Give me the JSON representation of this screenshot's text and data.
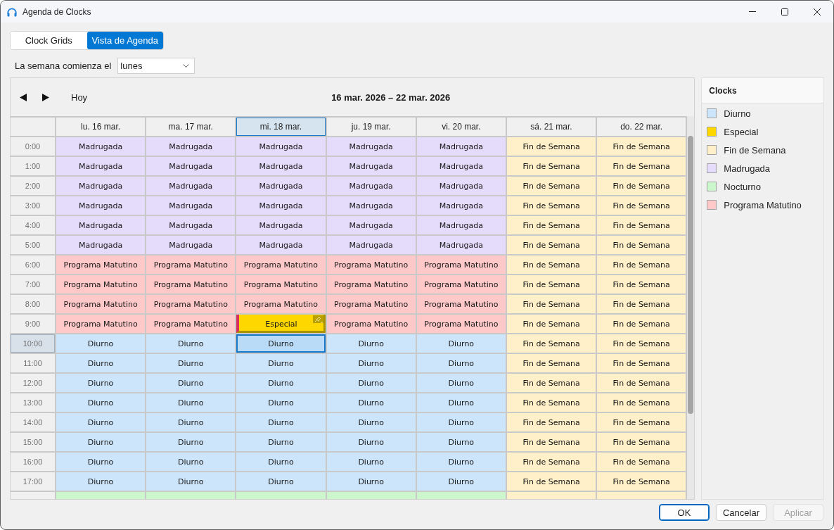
{
  "window": {
    "title": "Agenda de Clocks"
  },
  "tabs": [
    {
      "label": "Clock Grids",
      "selected": false
    },
    {
      "label": "Vista de Agenda",
      "selected": true
    }
  ],
  "week_start": {
    "label": "La semana comienza el",
    "value": "lunes"
  },
  "calendar": {
    "today_button": "Hoy",
    "range_title": "16 mar. 2026 – 22 mar. 2026",
    "days": [
      {
        "label": "lu. 16 mar.",
        "selected": false
      },
      {
        "label": "ma. 17 mar.",
        "selected": false
      },
      {
        "label": "mi. 18 mar.",
        "selected": true
      },
      {
        "label": "ju. 19 mar.",
        "selected": false
      },
      {
        "label": "vi. 20 mar.",
        "selected": false
      },
      {
        "label": "sá. 21 mar.",
        "selected": false
      },
      {
        "label": "do. 22 mar.",
        "selected": false
      }
    ],
    "rows": [
      {
        "time": "0:00",
        "selected": false,
        "cells": [
          {
            "text": "Madrugada",
            "color": "#e5dcfc",
            "pinned": false,
            "selected": false
          },
          {
            "text": "Madrugada",
            "color": "#e5dcfc",
            "pinned": false,
            "selected": false
          },
          {
            "text": "Madrugada",
            "color": "#e5dcfc",
            "pinned": false,
            "selected": false
          },
          {
            "text": "Madrugada",
            "color": "#e5dcfc",
            "pinned": false,
            "selected": false
          },
          {
            "text": "Madrugada",
            "color": "#e5dcfc",
            "pinned": false,
            "selected": false
          },
          {
            "text": "Fin de Semana",
            "color": "#fff0c9",
            "pinned": false,
            "selected": false
          },
          {
            "text": "Fin de Semana",
            "color": "#fff0c9",
            "pinned": false,
            "selected": false
          }
        ]
      },
      {
        "time": "1:00",
        "selected": false,
        "cells": [
          {
            "text": "Madrugada",
            "color": "#e5dcfc",
            "pinned": false,
            "selected": false
          },
          {
            "text": "Madrugada",
            "color": "#e5dcfc",
            "pinned": false,
            "selected": false
          },
          {
            "text": "Madrugada",
            "color": "#e5dcfc",
            "pinned": false,
            "selected": false
          },
          {
            "text": "Madrugada",
            "color": "#e5dcfc",
            "pinned": false,
            "selected": false
          },
          {
            "text": "Madrugada",
            "color": "#e5dcfc",
            "pinned": false,
            "selected": false
          },
          {
            "text": "Fin de Semana",
            "color": "#fff0c9",
            "pinned": false,
            "selected": false
          },
          {
            "text": "Fin de Semana",
            "color": "#fff0c9",
            "pinned": false,
            "selected": false
          }
        ]
      },
      {
        "time": "2:00",
        "selected": false,
        "cells": [
          {
            "text": "Madrugada",
            "color": "#e5dcfc",
            "pinned": false,
            "selected": false
          },
          {
            "text": "Madrugada",
            "color": "#e5dcfc",
            "pinned": false,
            "selected": false
          },
          {
            "text": "Madrugada",
            "color": "#e5dcfc",
            "pinned": false,
            "selected": false
          },
          {
            "text": "Madrugada",
            "color": "#e5dcfc",
            "pinned": false,
            "selected": false
          },
          {
            "text": "Madrugada",
            "color": "#e5dcfc",
            "pinned": false,
            "selected": false
          },
          {
            "text": "Fin de Semana",
            "color": "#fff0c9",
            "pinned": false,
            "selected": false
          },
          {
            "text": "Fin de Semana",
            "color": "#fff0c9",
            "pinned": false,
            "selected": false
          }
        ]
      },
      {
        "time": "3:00",
        "selected": false,
        "cells": [
          {
            "text": "Madrugada",
            "color": "#e5dcfc",
            "pinned": false,
            "selected": false
          },
          {
            "text": "Madrugada",
            "color": "#e5dcfc",
            "pinned": false,
            "selected": false
          },
          {
            "text": "Madrugada",
            "color": "#e5dcfc",
            "pinned": false,
            "selected": false
          },
          {
            "text": "Madrugada",
            "color": "#e5dcfc",
            "pinned": false,
            "selected": false
          },
          {
            "text": "Madrugada",
            "color": "#e5dcfc",
            "pinned": false,
            "selected": false
          },
          {
            "text": "Fin de Semana",
            "color": "#fff0c9",
            "pinned": false,
            "selected": false
          },
          {
            "text": "Fin de Semana",
            "color": "#fff0c9",
            "pinned": false,
            "selected": false
          }
        ]
      },
      {
        "time": "4:00",
        "selected": false,
        "cells": [
          {
            "text": "Madrugada",
            "color": "#e5dcfc",
            "pinned": false,
            "selected": false
          },
          {
            "text": "Madrugada",
            "color": "#e5dcfc",
            "pinned": false,
            "selected": false
          },
          {
            "text": "Madrugada",
            "color": "#e5dcfc",
            "pinned": false,
            "selected": false
          },
          {
            "text": "Madrugada",
            "color": "#e5dcfc",
            "pinned": false,
            "selected": false
          },
          {
            "text": "Madrugada",
            "color": "#e5dcfc",
            "pinned": false,
            "selected": false
          },
          {
            "text": "Fin de Semana",
            "color": "#fff0c9",
            "pinned": false,
            "selected": false
          },
          {
            "text": "Fin de Semana",
            "color": "#fff0c9",
            "pinned": false,
            "selected": false
          }
        ]
      },
      {
        "time": "5:00",
        "selected": false,
        "cells": [
          {
            "text": "Madrugada",
            "color": "#e5dcfc",
            "pinned": false,
            "selected": false
          },
          {
            "text": "Madrugada",
            "color": "#e5dcfc",
            "pinned": false,
            "selected": false
          },
          {
            "text": "Madrugada",
            "color": "#e5dcfc",
            "pinned": false,
            "selected": false
          },
          {
            "text": "Madrugada",
            "color": "#e5dcfc",
            "pinned": false,
            "selected": false
          },
          {
            "text": "Madrugada",
            "color": "#e5dcfc",
            "pinned": false,
            "selected": false
          },
          {
            "text": "Fin de Semana",
            "color": "#fff0c9",
            "pinned": false,
            "selected": false
          },
          {
            "text": "Fin de Semana",
            "color": "#fff0c9",
            "pinned": false,
            "selected": false
          }
        ]
      },
      {
        "time": "6:00",
        "selected": false,
        "cells": [
          {
            "text": "Programa Matutino",
            "color": "#ffc9c9",
            "pinned": false,
            "selected": false
          },
          {
            "text": "Programa Matutino",
            "color": "#ffc9c9",
            "pinned": false,
            "selected": false
          },
          {
            "text": "Programa Matutino",
            "color": "#ffc9c9",
            "pinned": false,
            "selected": false
          },
          {
            "text": "Programa Matutino",
            "color": "#ffc9c9",
            "pinned": false,
            "selected": false
          },
          {
            "text": "Programa Matutino",
            "color": "#ffc9c9",
            "pinned": false,
            "selected": false
          },
          {
            "text": "Fin de Semana",
            "color": "#fff0c9",
            "pinned": false,
            "selected": false
          },
          {
            "text": "Fin de Semana",
            "color": "#fff0c9",
            "pinned": false,
            "selected": false
          }
        ]
      },
      {
        "time": "7:00",
        "selected": false,
        "cells": [
          {
            "text": "Programa Matutino",
            "color": "#ffc9c9",
            "pinned": false,
            "selected": false
          },
          {
            "text": "Programa Matutino",
            "color": "#ffc9c9",
            "pinned": false,
            "selected": false
          },
          {
            "text": "Programa Matutino",
            "color": "#ffc9c9",
            "pinned": false,
            "selected": false
          },
          {
            "text": "Programa Matutino",
            "color": "#ffc9c9",
            "pinned": false,
            "selected": false
          },
          {
            "text": "Programa Matutino",
            "color": "#ffc9c9",
            "pinned": false,
            "selected": false
          },
          {
            "text": "Fin de Semana",
            "color": "#fff0c9",
            "pinned": false,
            "selected": false
          },
          {
            "text": "Fin de Semana",
            "color": "#fff0c9",
            "pinned": false,
            "selected": false
          }
        ]
      },
      {
        "time": "8:00",
        "selected": false,
        "cells": [
          {
            "text": "Programa Matutino",
            "color": "#ffc9c9",
            "pinned": false,
            "selected": false
          },
          {
            "text": "Programa Matutino",
            "color": "#ffc9c9",
            "pinned": false,
            "selected": false
          },
          {
            "text": "Programa Matutino",
            "color": "#ffc9c9",
            "pinned": false,
            "selected": false
          },
          {
            "text": "Programa Matutino",
            "color": "#ffc9c9",
            "pinned": false,
            "selected": false
          },
          {
            "text": "Programa Matutino",
            "color": "#ffc9c9",
            "pinned": false,
            "selected": false
          },
          {
            "text": "Fin de Semana",
            "color": "#fff0c9",
            "pinned": false,
            "selected": false
          },
          {
            "text": "Fin de Semana",
            "color": "#fff0c9",
            "pinned": false,
            "selected": false
          }
        ]
      },
      {
        "time": "9:00",
        "selected": false,
        "cells": [
          {
            "text": "Programa Matutino",
            "color": "#ffc9c9",
            "pinned": false,
            "selected": false
          },
          {
            "text": "Programa Matutino",
            "color": "#ffc9c9",
            "pinned": false,
            "selected": false
          },
          {
            "text": "Especial",
            "color": "#ffd700",
            "pinned": true,
            "selected": false
          },
          {
            "text": "Programa Matutino",
            "color": "#ffc9c9",
            "pinned": false,
            "selected": false
          },
          {
            "text": "Programa Matutino",
            "color": "#ffc9c9",
            "pinned": false,
            "selected": false
          },
          {
            "text": "Fin de Semana",
            "color": "#fff0c9",
            "pinned": false,
            "selected": false
          },
          {
            "text": "Fin de Semana",
            "color": "#fff0c9",
            "pinned": false,
            "selected": false
          }
        ]
      },
      {
        "time": "10:00",
        "selected": true,
        "cells": [
          {
            "text": "Diurno",
            "color": "#cce5fb",
            "pinned": false,
            "selected": false
          },
          {
            "text": "Diurno",
            "color": "#cce5fb",
            "pinned": false,
            "selected": false
          },
          {
            "text": "Diurno",
            "color": "#badbf7",
            "pinned": false,
            "selected": true
          },
          {
            "text": "Diurno",
            "color": "#cce5fb",
            "pinned": false,
            "selected": false
          },
          {
            "text": "Diurno",
            "color": "#cce5fb",
            "pinned": false,
            "selected": false
          },
          {
            "text": "Fin de Semana",
            "color": "#fff0c9",
            "pinned": false,
            "selected": false
          },
          {
            "text": "Fin de Semana",
            "color": "#fff0c9",
            "pinned": false,
            "selected": false
          }
        ]
      },
      {
        "time": "11:00",
        "selected": false,
        "cells": [
          {
            "text": "Diurno",
            "color": "#cce5fb",
            "pinned": false,
            "selected": false
          },
          {
            "text": "Diurno",
            "color": "#cce5fb",
            "pinned": false,
            "selected": false
          },
          {
            "text": "Diurno",
            "color": "#cce5fb",
            "pinned": false,
            "selected": false
          },
          {
            "text": "Diurno",
            "color": "#cce5fb",
            "pinned": false,
            "selected": false
          },
          {
            "text": "Diurno",
            "color": "#cce5fb",
            "pinned": false,
            "selected": false
          },
          {
            "text": "Fin de Semana",
            "color": "#fff0c9",
            "pinned": false,
            "selected": false
          },
          {
            "text": "Fin de Semana",
            "color": "#fff0c9",
            "pinned": false,
            "selected": false
          }
        ]
      },
      {
        "time": "12:00",
        "selected": false,
        "cells": [
          {
            "text": "Diurno",
            "color": "#cce5fb",
            "pinned": false,
            "selected": false
          },
          {
            "text": "Diurno",
            "color": "#cce5fb",
            "pinned": false,
            "selected": false
          },
          {
            "text": "Diurno",
            "color": "#cce5fb",
            "pinned": false,
            "selected": false
          },
          {
            "text": "Diurno",
            "color": "#cce5fb",
            "pinned": false,
            "selected": false
          },
          {
            "text": "Diurno",
            "color": "#cce5fb",
            "pinned": false,
            "selected": false
          },
          {
            "text": "Fin de Semana",
            "color": "#fff0c9",
            "pinned": false,
            "selected": false
          },
          {
            "text": "Fin de Semana",
            "color": "#fff0c9",
            "pinned": false,
            "selected": false
          }
        ]
      },
      {
        "time": "13:00",
        "selected": false,
        "cells": [
          {
            "text": "Diurno",
            "color": "#cce5fb",
            "pinned": false,
            "selected": false
          },
          {
            "text": "Diurno",
            "color": "#cce5fb",
            "pinned": false,
            "selected": false
          },
          {
            "text": "Diurno",
            "color": "#cce5fb",
            "pinned": false,
            "selected": false
          },
          {
            "text": "Diurno",
            "color": "#cce5fb",
            "pinned": false,
            "selected": false
          },
          {
            "text": "Diurno",
            "color": "#cce5fb",
            "pinned": false,
            "selected": false
          },
          {
            "text": "Fin de Semana",
            "color": "#fff0c9",
            "pinned": false,
            "selected": false
          },
          {
            "text": "Fin de Semana",
            "color": "#fff0c9",
            "pinned": false,
            "selected": false
          }
        ]
      },
      {
        "time": "14:00",
        "selected": false,
        "cells": [
          {
            "text": "Diurno",
            "color": "#cce5fb",
            "pinned": false,
            "selected": false
          },
          {
            "text": "Diurno",
            "color": "#cce5fb",
            "pinned": false,
            "selected": false
          },
          {
            "text": "Diurno",
            "color": "#cce5fb",
            "pinned": false,
            "selected": false
          },
          {
            "text": "Diurno",
            "color": "#cce5fb",
            "pinned": false,
            "selected": false
          },
          {
            "text": "Diurno",
            "color": "#cce5fb",
            "pinned": false,
            "selected": false
          },
          {
            "text": "Fin de Semana",
            "color": "#fff0c9",
            "pinned": false,
            "selected": false
          },
          {
            "text": "Fin de Semana",
            "color": "#fff0c9",
            "pinned": false,
            "selected": false
          }
        ]
      },
      {
        "time": "15:00",
        "selected": false,
        "cells": [
          {
            "text": "Diurno",
            "color": "#cce5fb",
            "pinned": false,
            "selected": false
          },
          {
            "text": "Diurno",
            "color": "#cce5fb",
            "pinned": false,
            "selected": false
          },
          {
            "text": "Diurno",
            "color": "#cce5fb",
            "pinned": false,
            "selected": false
          },
          {
            "text": "Diurno",
            "color": "#cce5fb",
            "pinned": false,
            "selected": false
          },
          {
            "text": "Diurno",
            "color": "#cce5fb",
            "pinned": false,
            "selected": false
          },
          {
            "text": "Fin de Semana",
            "color": "#fff0c9",
            "pinned": false,
            "selected": false
          },
          {
            "text": "Fin de Semana",
            "color": "#fff0c9",
            "pinned": false,
            "selected": false
          }
        ]
      },
      {
        "time": "16:00",
        "selected": false,
        "cells": [
          {
            "text": "Diurno",
            "color": "#cce5fb",
            "pinned": false,
            "selected": false
          },
          {
            "text": "Diurno",
            "color": "#cce5fb",
            "pinned": false,
            "selected": false
          },
          {
            "text": "Diurno",
            "color": "#cce5fb",
            "pinned": false,
            "selected": false
          },
          {
            "text": "Diurno",
            "color": "#cce5fb",
            "pinned": false,
            "selected": false
          },
          {
            "text": "Diurno",
            "color": "#cce5fb",
            "pinned": false,
            "selected": false
          },
          {
            "text": "Fin de Semana",
            "color": "#fff0c9",
            "pinned": false,
            "selected": false
          },
          {
            "text": "Fin de Semana",
            "color": "#fff0c9",
            "pinned": false,
            "selected": false
          }
        ]
      },
      {
        "time": "17:00",
        "selected": false,
        "cells": [
          {
            "text": "Diurno",
            "color": "#cce5fb",
            "pinned": false,
            "selected": false
          },
          {
            "text": "Diurno",
            "color": "#cce5fb",
            "pinned": false,
            "selected": false
          },
          {
            "text": "Diurno",
            "color": "#cce5fb",
            "pinned": false,
            "selected": false
          },
          {
            "text": "Diurno",
            "color": "#cce5fb",
            "pinned": false,
            "selected": false
          },
          {
            "text": "Diurno",
            "color": "#cce5fb",
            "pinned": false,
            "selected": false
          },
          {
            "text": "Fin de Semana",
            "color": "#fff0c9",
            "pinned": false,
            "selected": false
          },
          {
            "text": "Fin de Semana",
            "color": "#fff0c9",
            "pinned": false,
            "selected": false
          }
        ]
      },
      {
        "selected": false,
        "cells": [
          {
            "color": "#ccf7cc",
            "pinned": false,
            "selected": false
          },
          {
            "color": "#ccf7cc",
            "pinned": false,
            "selected": false
          },
          {
            "color": "#ccf7cc",
            "pinned": false,
            "selected": false
          },
          {
            "color": "#ccf7cc",
            "pinned": false,
            "selected": false
          },
          {
            "color": "#ccf7cc",
            "pinned": false,
            "selected": false
          },
          {
            "color": "#fff0c9",
            "pinned": false,
            "selected": false
          },
          {
            "color": "#fff0c9",
            "pinned": false,
            "selected": false
          }
        ]
      }
    ]
  },
  "legend": {
    "title": "Clocks",
    "items": [
      {
        "name": "Diurno",
        "color": "#cce5fb"
      },
      {
        "name": "Especial",
        "color": "#ffd700"
      },
      {
        "name": "Fin de Semana",
        "color": "#fff0c9"
      },
      {
        "name": "Madrugada",
        "color": "#e5dcfc"
      },
      {
        "name": "Nocturno",
        "color": "#ccf7cc"
      },
      {
        "name": "Programa Matutino",
        "color": "#ffc9c9"
      }
    ]
  },
  "buttons": [
    {
      "label": "OK",
      "default": true,
      "disabled": false
    },
    {
      "label": "Cancelar",
      "default": false,
      "disabled": false
    },
    {
      "label": "Aplicar",
      "default": false,
      "disabled": true
    }
  ]
}
